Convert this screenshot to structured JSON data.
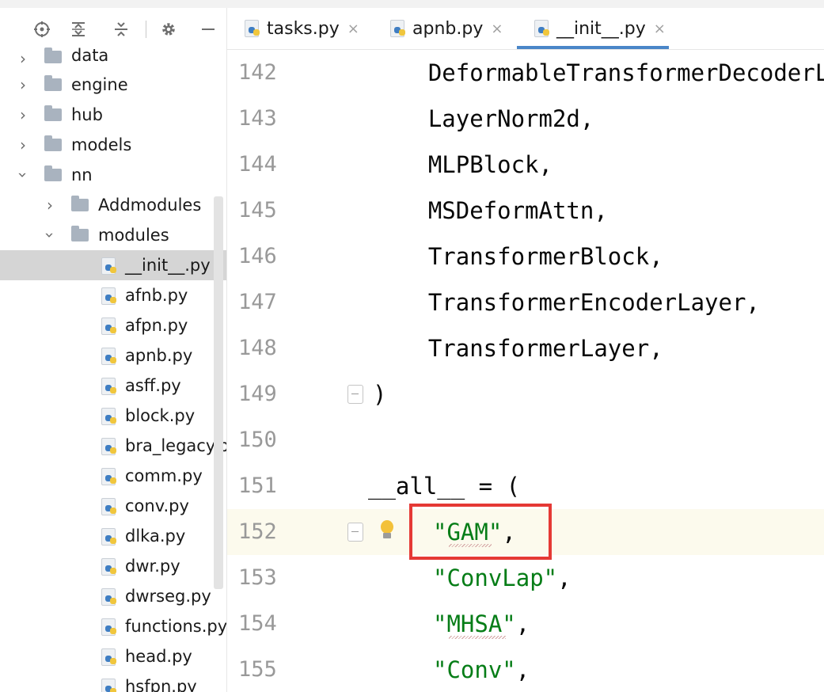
{
  "toolbar": {
    "icons": [
      "locate-icon",
      "expand-all-icon",
      "collapse-all-icon",
      "gear-icon",
      "minimize-icon"
    ]
  },
  "tabs": [
    {
      "label": "tasks.py",
      "close": "×"
    },
    {
      "label": "apnb.py",
      "close": "×"
    },
    {
      "label": "__init__.py",
      "close": "×"
    }
  ],
  "tree": {
    "folders": [
      "data",
      "engine",
      "hub",
      "models",
      "nn",
      "Addmodules",
      "modules"
    ],
    "files": [
      "__init__.py",
      "afnb.py",
      "afpn.py",
      "apnb.py",
      "asff.py",
      "block.py",
      "bra_legacy.py",
      "comm.py",
      "conv.py",
      "dlka.py",
      "dwr.py",
      "dwrseg.py",
      "functions.py",
      "head.py",
      "hsfpn.py"
    ]
  },
  "editor": {
    "lines": [
      {
        "num": "142",
        "code": "    DeformableTransformerDecoderLayer,"
      },
      {
        "num": "143",
        "code": "    LayerNorm2d,"
      },
      {
        "num": "144",
        "code": "    MLPBlock,"
      },
      {
        "num": "145",
        "code": "    MSDeformAttn,"
      },
      {
        "num": "146",
        "code": "    TransformerBlock,"
      },
      {
        "num": "147",
        "code": "    TransformerEncoderLayer,"
      },
      {
        "num": "148",
        "code": "    TransformerLayer,"
      },
      {
        "num": "149",
        "code": ")"
      },
      {
        "num": "150",
        "code": ""
      },
      {
        "num": "151",
        "code": "__all__ = ("
      },
      {
        "num": "152",
        "str": "\"GAM\"",
        "tail": ","
      },
      {
        "num": "153",
        "str": "\"ConvLap\"",
        "tail": ","
      },
      {
        "num": "154",
        "str": "\"MHSA\"",
        "tail": ","
      },
      {
        "num": "155",
        "str": "\"Conv\"",
        "tail": ","
      }
    ]
  },
  "colors": {
    "highlight_box": "#e53935",
    "string": "#067d17",
    "current_line": "#fcfaed",
    "active_tab_underline": "#4a86c8"
  }
}
